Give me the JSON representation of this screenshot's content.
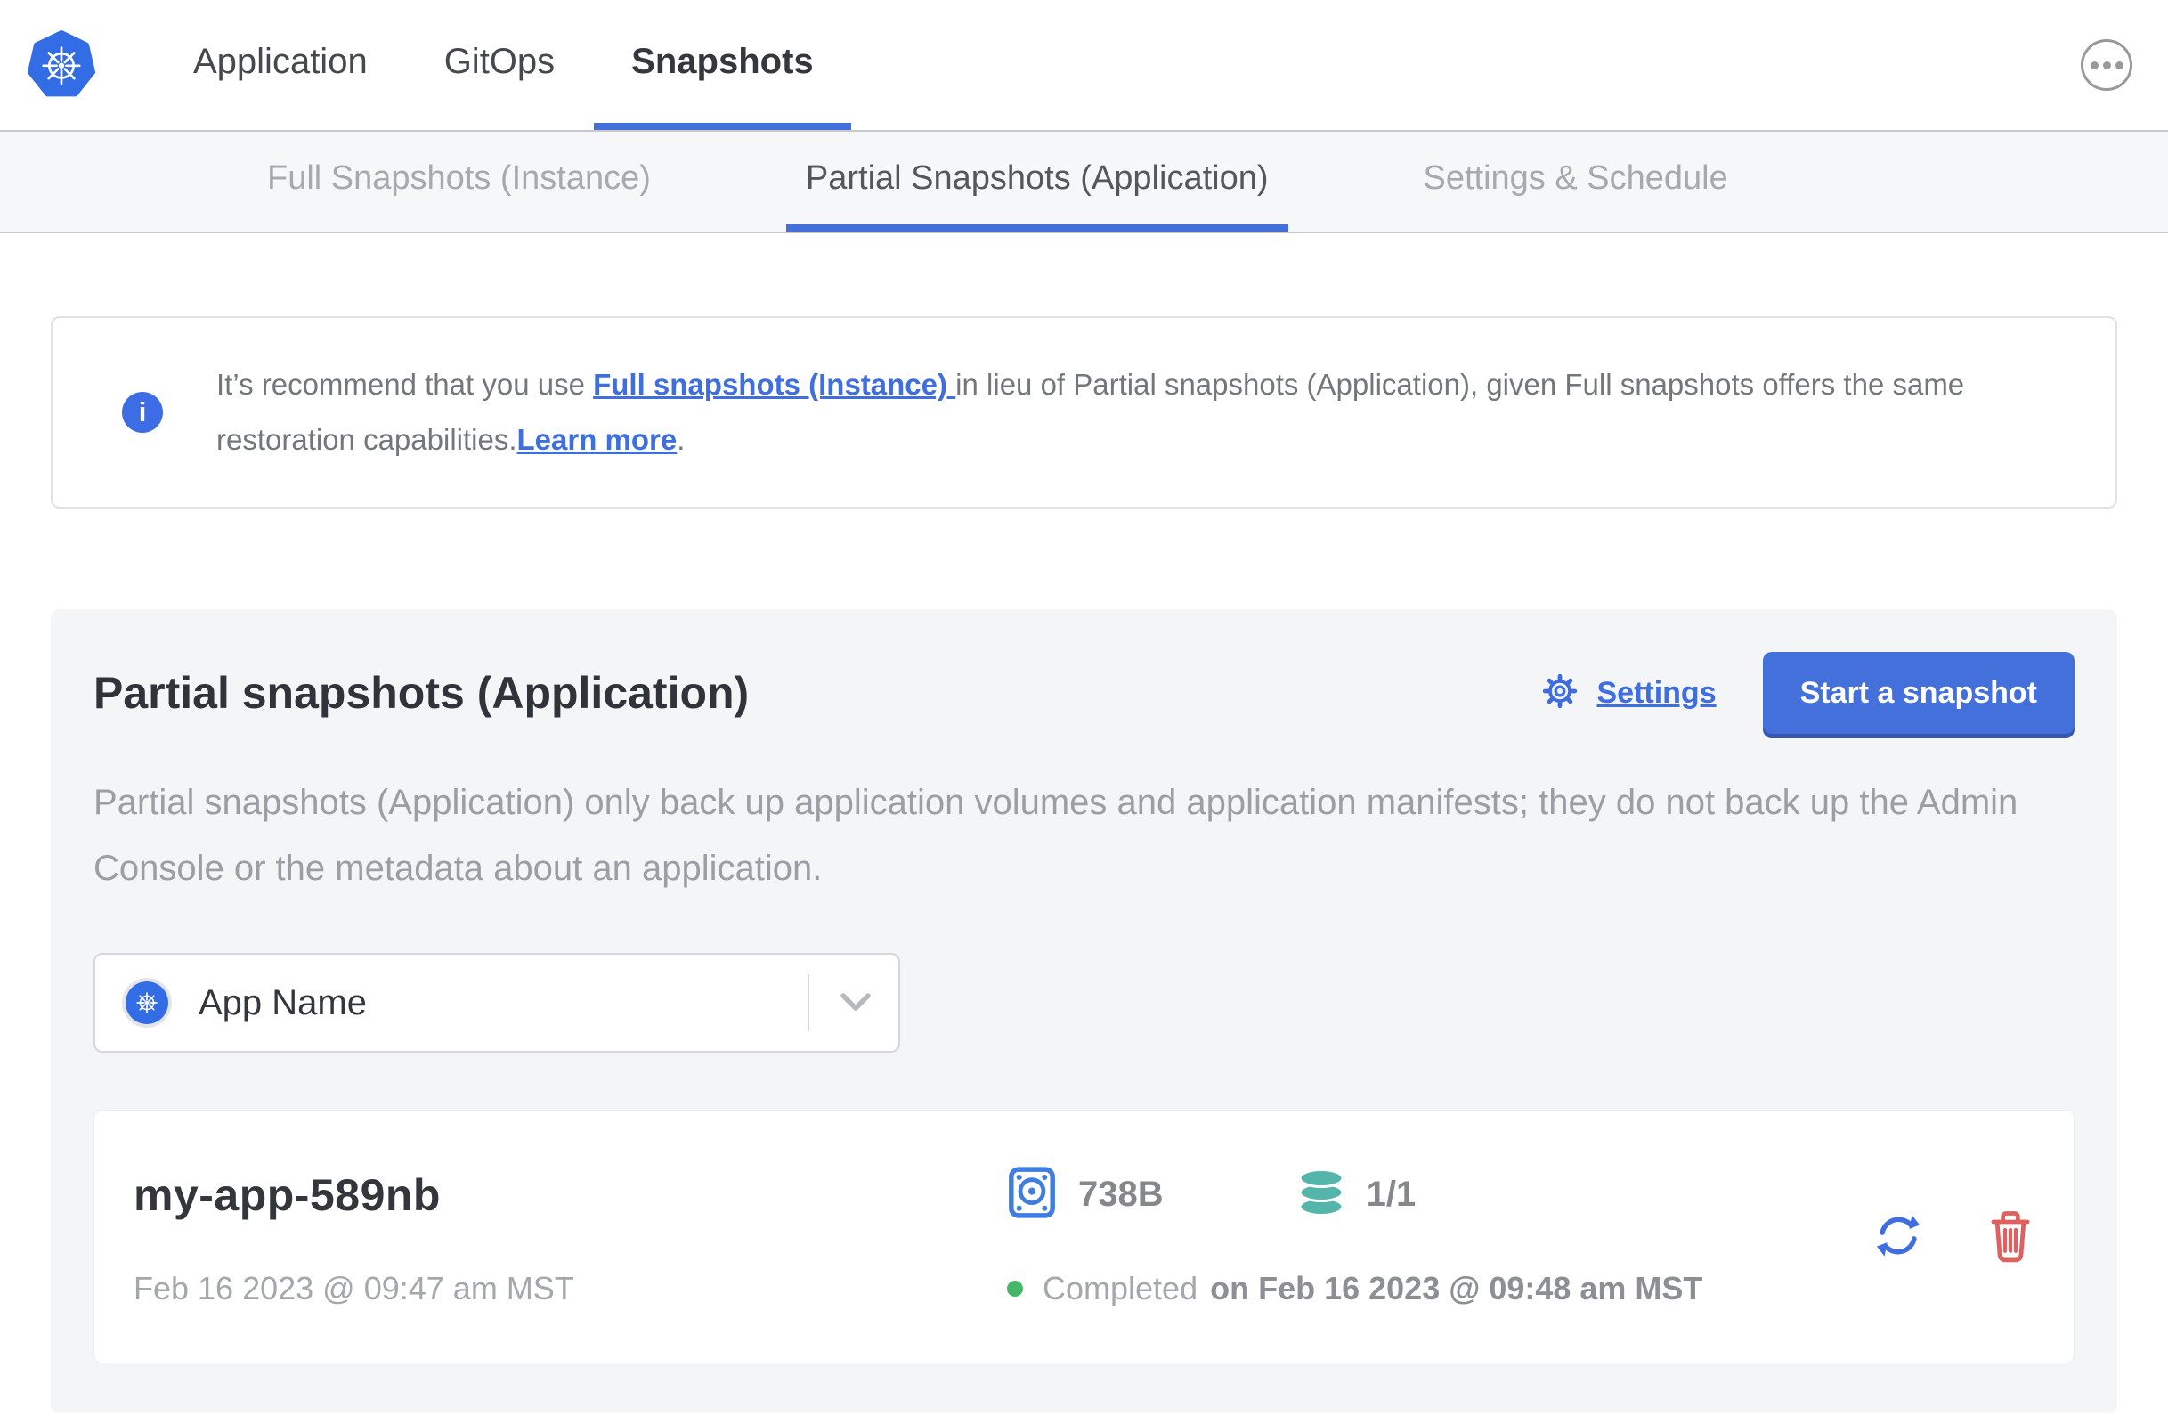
{
  "nav": {
    "brand_icon": "kubernetes-logo",
    "items": [
      {
        "label": "Application",
        "active": false
      },
      {
        "label": "GitOps",
        "active": false
      },
      {
        "label": "Snapshots",
        "active": true
      }
    ],
    "menu_icon": "ellipsis-menu"
  },
  "subnav": {
    "tabs": [
      {
        "label": "Full Snapshots (Instance)",
        "active": false
      },
      {
        "label": "Partial Snapshots (Application)",
        "active": true
      },
      {
        "label": "Settings & Schedule",
        "active": false
      }
    ]
  },
  "banner": {
    "icon": "info-icon",
    "text_1": "It’s recommend that you use ",
    "link_full_snapshots": "Full snapshots (Instance) ",
    "text_2": "in lieu of Partial snapshots (Application), given Full snapshots offers the same restoration capabilities.",
    "link_learn_more": "Learn more",
    "text_3": "."
  },
  "panel": {
    "title": "Partial snapshots (Application)",
    "settings_label": "Settings",
    "start_button_label": "Start a snapshot",
    "description": "Partial snapshots (Application) only back up application volumes and application manifests; they do not back up the Admin Console or the metadata about an application.",
    "app_selector": {
      "icon": "kubernetes-icon",
      "value": "App Name"
    }
  },
  "snapshot": {
    "name": "my-app-589nb",
    "started": "Feb 16 2023 @ 09:47 am MST",
    "size": "738B",
    "volumes": "1/1",
    "status": "Completed",
    "status_detail": "on Feb 16 2023 @ 09:48 am MST"
  },
  "colors": {
    "accent_blue": "#4370db",
    "link_blue": "#3e6ee0",
    "kubernetes_blue": "#326de6",
    "volume_teal": "#54b5ab",
    "delete_red": "#e05f5f",
    "status_green": "#44b866"
  }
}
